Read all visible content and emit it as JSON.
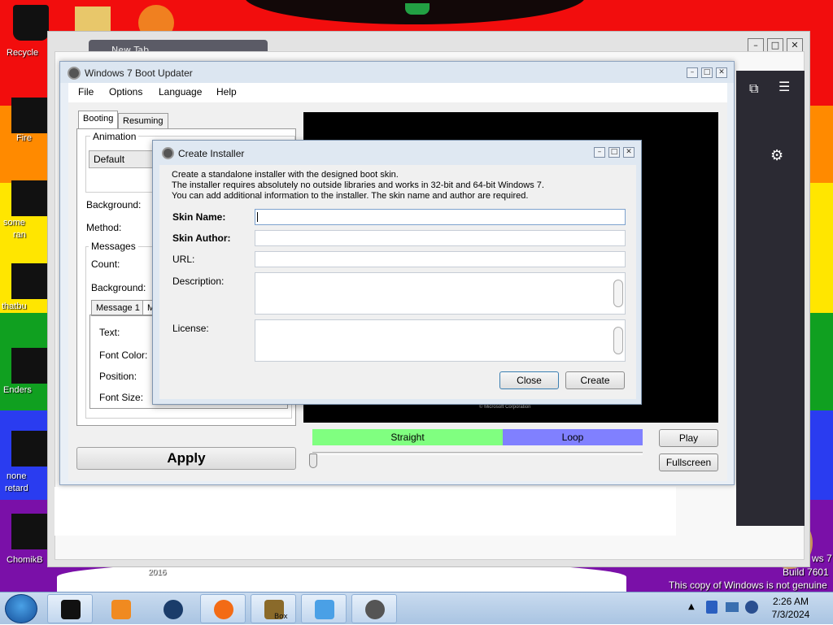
{
  "desktop": {
    "icons": [
      {
        "label": "Recycle"
      },
      {
        "label": "Fire"
      },
      {
        "label": "some"
      },
      {
        "label": "ran"
      },
      {
        "label": "thatbu"
      },
      {
        "label": "Enders"
      },
      {
        "label": "none"
      },
      {
        "label": "retard"
      },
      {
        "label": "ChomikB"
      }
    ],
    "year_label": "2016",
    "watermark": {
      "line1": "ws 7",
      "line2": "Build 7601",
      "line3": "This copy of Windows is not genuine"
    }
  },
  "background_window": {
    "tab_title": "New Tab"
  },
  "main_window": {
    "title": "Windows 7 Boot Updater",
    "menu": [
      "File",
      "Options",
      "Language",
      "Help"
    ],
    "tabs": [
      "Booting",
      "Resuming"
    ],
    "animation_group": "Animation",
    "animation_value": "Default",
    "background_label": "Background:",
    "method_label": "Method:",
    "messages_group": "Messages",
    "count_label": "Count:",
    "msg_background_label": "Background:",
    "message_tabs": [
      "Message 1",
      "M"
    ],
    "text_label": "Text:",
    "font_color_label": "Font Color:",
    "position_label": "Position:",
    "font_size_label": "Font Size:",
    "apply_label": "Apply",
    "copyright": "© Microsoft Corporation",
    "straight_label": "Straight",
    "loop_label": "Loop",
    "play_label": "Play",
    "fullscreen_label": "Fullscreen",
    "colors": {
      "straight": "#80ff80",
      "loop": "#8080ff"
    }
  },
  "dialog": {
    "title": "Create Installer",
    "desc_line1": "Create a standalone installer with the designed boot skin.",
    "desc_line2": "The installer requires absolutely no outside libraries and works in 32-bit and 64-bit Windows 7.",
    "desc_line3": "You can add additional information to the installer. The skin name and author are required.",
    "skin_name_label": "Skin Name:",
    "skin_author_label": "Skin Author:",
    "url_label": "URL:",
    "description_label": "Description:",
    "license_label": "License:",
    "skin_name_value": "",
    "skin_author_value": "",
    "url_value": "",
    "close_label": "Close",
    "create_label": "Create"
  },
  "taskbar": {
    "time": "2:26 AM",
    "date": "7/3/2024",
    "box_label": "Box"
  }
}
